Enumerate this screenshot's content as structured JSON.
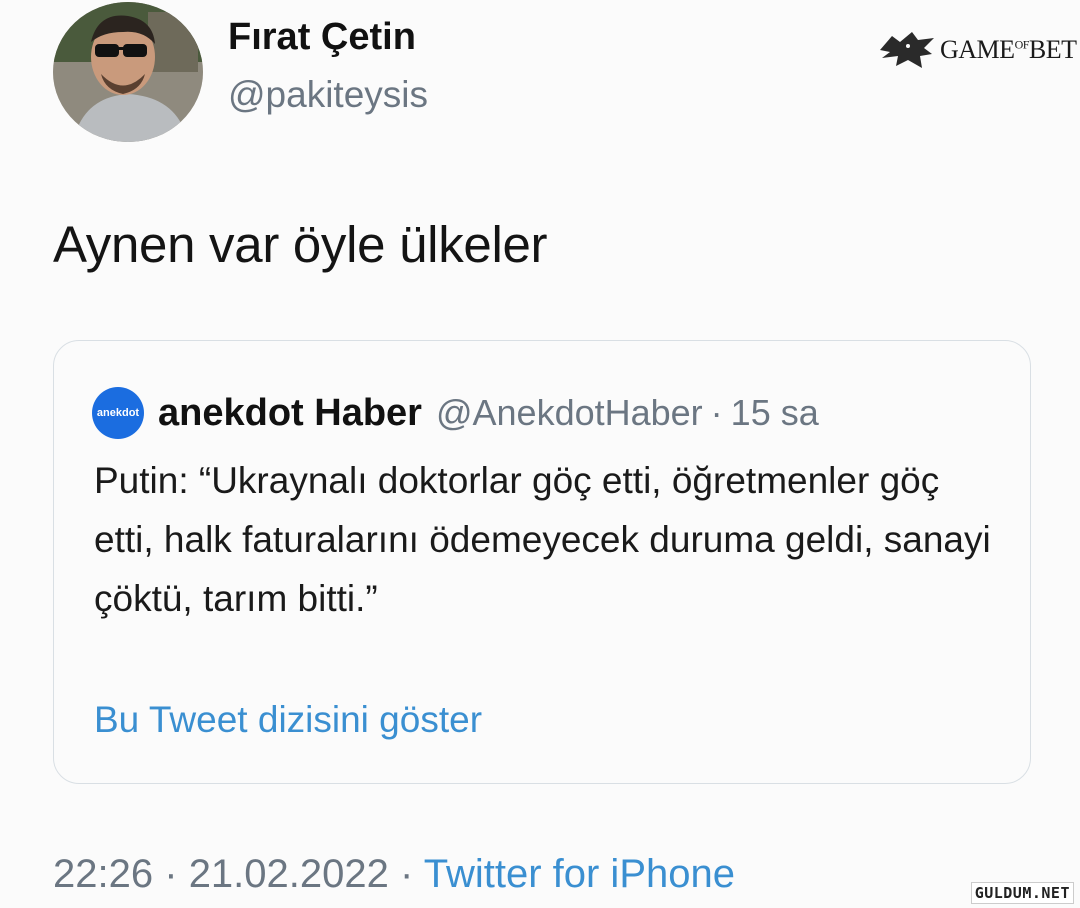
{
  "author": {
    "display_name": "Fırat Çetin",
    "handle": "@pakiteysis"
  },
  "brand_logo": {
    "text_main": "GAME",
    "text_small": "OF",
    "text_end": "BET",
    "icon": "wolf-head-icon"
  },
  "tweet": {
    "text": "Aynen var öyle ülkeler"
  },
  "quoted_tweet": {
    "avatar_text": "anekdot",
    "display_name": "anekdot Haber",
    "handle": "@AnekdotHaber",
    "separator": "·",
    "time": "15 sa",
    "text": "Putin: “Ukraynalı doktorlar göç etti, öğretmenler göç etti, halk faturalarını ödemeyecek duruma geldi, sanayi çöktü, tarım bitti.”",
    "show_thread": "Bu Tweet dizisini göster"
  },
  "meta": {
    "time": "22:26",
    "sep1": "·",
    "date": "21.02.2022",
    "sep2": "·",
    "source": "Twitter for iPhone"
  },
  "watermark": "GULDUM.NET",
  "colors": {
    "link": "#3a8fd1",
    "muted": "#6b7682",
    "anekdot_blue": "#1b6de0"
  }
}
